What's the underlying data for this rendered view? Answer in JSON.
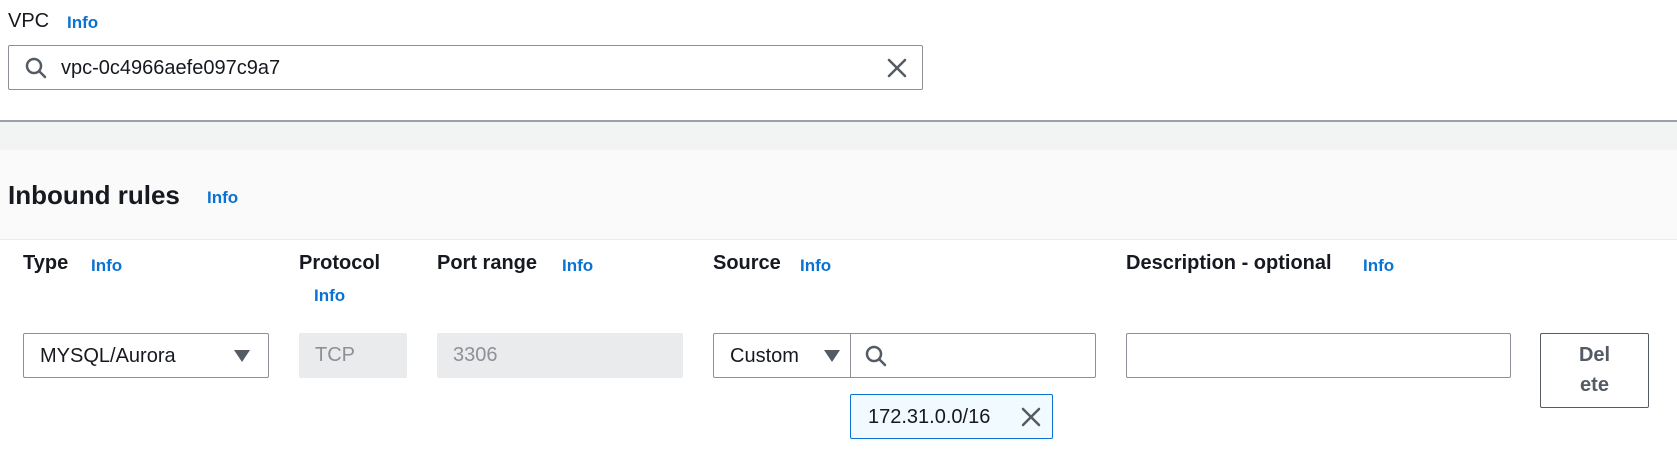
{
  "vpc": {
    "label": "VPC",
    "info": "Info",
    "value": "vpc-0c4966aefe097c9a7"
  },
  "inbound": {
    "title": "Inbound rules",
    "info": "Info",
    "columns": {
      "type": "Type",
      "type_info": "Info",
      "protocol": "Protocol",
      "protocol_info": "Info",
      "port_range": "Port range",
      "port_range_info": "Info",
      "source": "Source",
      "source_info": "Info",
      "description": "Description - optional",
      "description_info": "Info"
    },
    "rule": {
      "type": "MYSQL/Aurora",
      "protocol": "TCP",
      "port_range": "3306",
      "source_mode": "Custom",
      "source_search": "",
      "source_token": "172.31.0.0/16",
      "description": "",
      "delete_label_1": "Del",
      "delete_label_2": "ete"
    }
  },
  "colors": {
    "link": "#0972d3",
    "text": "#16191f",
    "border": "#8d9096",
    "disabled_bg": "#e9ebed",
    "token_bg": "#f1faff"
  },
  "icons": {
    "vpc_search": "search-icon",
    "vpc_clear": "close-icon",
    "type_caret": "caret-down-icon",
    "source_caret": "caret-down-icon",
    "source_search": "search-icon",
    "token_remove": "close-icon"
  }
}
